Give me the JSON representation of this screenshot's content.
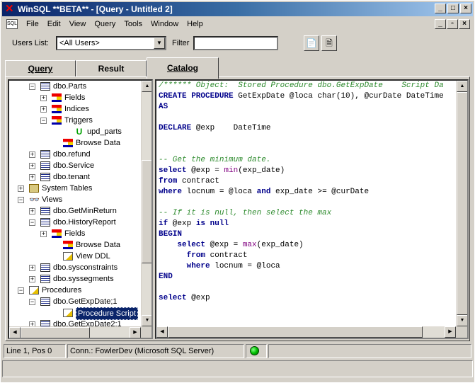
{
  "window": {
    "title": "WinSQL **BETA** - [Query - Untitled 2]",
    "controls": [
      "_",
      "□",
      "×"
    ],
    "mdi_controls": [
      "_",
      "▫",
      "×"
    ]
  },
  "menu": [
    "File",
    "Edit",
    "View",
    "Query",
    "Tools",
    "Window",
    "Help"
  ],
  "filterbar": {
    "users_label": "Users List:",
    "users_value": "<All Users>",
    "filter_label": "Filter",
    "filter_value": ""
  },
  "tabs": [
    "Query",
    "Result",
    "Catalog"
  ],
  "active_tab": "Catalog",
  "tree": [
    {
      "label": "dbo.Parts",
      "icon": "table-icon",
      "expander": "-"
    },
    {
      "label": "Fields",
      "icon": "fields-icon",
      "expander": "+"
    },
    {
      "label": "Indices",
      "icon": "fields-icon",
      "expander": "+"
    },
    {
      "label": "Triggers",
      "icon": "fields-icon",
      "expander": "-"
    },
    {
      "label": "upd_parts",
      "icon": "trigger-icon",
      "expander": ""
    },
    {
      "label": "Browse Data",
      "icon": "fields-icon",
      "expander": ""
    },
    {
      "label": "dbo.refund",
      "icon": "table-icon",
      "expander": "+"
    },
    {
      "label": "dbo.Service",
      "icon": "table-icon",
      "expander": "+"
    },
    {
      "label": "dbo.tenant",
      "icon": "table-icon",
      "expander": "+"
    },
    {
      "label": "System Tables",
      "icon": "folder-icon",
      "expander": "+"
    },
    {
      "label": "Views",
      "icon": "glasses-icon",
      "expander": "-"
    },
    {
      "label": "dbo.GetMinReturn",
      "icon": "table-icon",
      "expander": "+"
    },
    {
      "label": "dbo.HistoryReport",
      "icon": "table-icon",
      "expander": "-"
    },
    {
      "label": "Fields",
      "icon": "fields-icon",
      "expander": "+"
    },
    {
      "label": "Browse Data",
      "icon": "fields-icon",
      "expander": ""
    },
    {
      "label": "View DDL",
      "icon": "ddl-icon",
      "expander": ""
    },
    {
      "label": "dbo.sysconstraints",
      "icon": "table-icon",
      "expander": "+"
    },
    {
      "label": "dbo.syssegments",
      "icon": "table-icon",
      "expander": "+"
    },
    {
      "label": "Procedures",
      "icon": "pencil-doc-icon",
      "expander": "-"
    },
    {
      "label": "dbo.GetExpDate;1",
      "icon": "proc-icon",
      "expander": "-"
    },
    {
      "label": "Procedure Script",
      "icon": "ddl-icon",
      "expander": "",
      "selected": true
    },
    {
      "label": "dbo.GetExpDate2;1",
      "icon": "proc-icon",
      "expander": "+"
    }
  ],
  "code": [
    [
      [
        "cm",
        "/****** Object:  Stored Procedure dbo.GetExpDate    Script Da"
      ]
    ],
    [
      [
        "kw",
        "CREATE PROCEDURE"
      ],
      [
        "tx",
        " GetExpDate @loca "
      ],
      [
        "tx",
        "char(10), @curDate DateTime"
      ]
    ],
    [
      [
        "kw",
        "AS"
      ]
    ],
    [
      [
        "tx",
        ""
      ]
    ],
    [
      [
        "kw",
        "DECLARE"
      ],
      [
        "tx",
        " @exp    DateTime"
      ]
    ],
    [
      [
        "tx",
        ""
      ]
    ],
    [
      [
        "tx",
        ""
      ]
    ],
    [
      [
        "cm",
        "-- Get the minimum date."
      ]
    ],
    [
      [
        "kw",
        "select"
      ],
      [
        "tx",
        " @exp = "
      ],
      [
        "fn",
        "min"
      ],
      [
        "tx",
        "(exp_date)"
      ]
    ],
    [
      [
        "kw",
        "from"
      ],
      [
        "tx",
        " contract"
      ]
    ],
    [
      [
        "kw",
        "where"
      ],
      [
        "tx",
        " locnum = @loca "
      ],
      [
        "kw",
        "and"
      ],
      [
        "tx",
        " exp_date >= @curDate"
      ]
    ],
    [
      [
        "tx",
        ""
      ]
    ],
    [
      [
        "cm",
        "-- If it is null, then select the max"
      ]
    ],
    [
      [
        "kw",
        "if"
      ],
      [
        "tx",
        " @exp "
      ],
      [
        "kw",
        "is null"
      ]
    ],
    [
      [
        "kw",
        "BEGIN"
      ]
    ],
    [
      [
        "tx",
        "    "
      ],
      [
        "kw",
        "select"
      ],
      [
        "tx",
        " @exp = "
      ],
      [
        "fn",
        "max"
      ],
      [
        "tx",
        "(exp_date)"
      ]
    ],
    [
      [
        "tx",
        "      "
      ],
      [
        "kw",
        "from"
      ],
      [
        "tx",
        " contract"
      ]
    ],
    [
      [
        "tx",
        "      "
      ],
      [
        "kw",
        "where"
      ],
      [
        "tx",
        " locnum = @loca"
      ]
    ],
    [
      [
        "kw",
        "END"
      ]
    ],
    [
      [
        "tx",
        ""
      ]
    ],
    [
      [
        "kw",
        "select"
      ],
      [
        "tx",
        " @exp"
      ]
    ]
  ],
  "status": {
    "position": "Line 1, Pos 0",
    "connection": "Conn.: FowlerDev (Microsoft SQL Server)",
    "connection_color": "#00c000"
  }
}
